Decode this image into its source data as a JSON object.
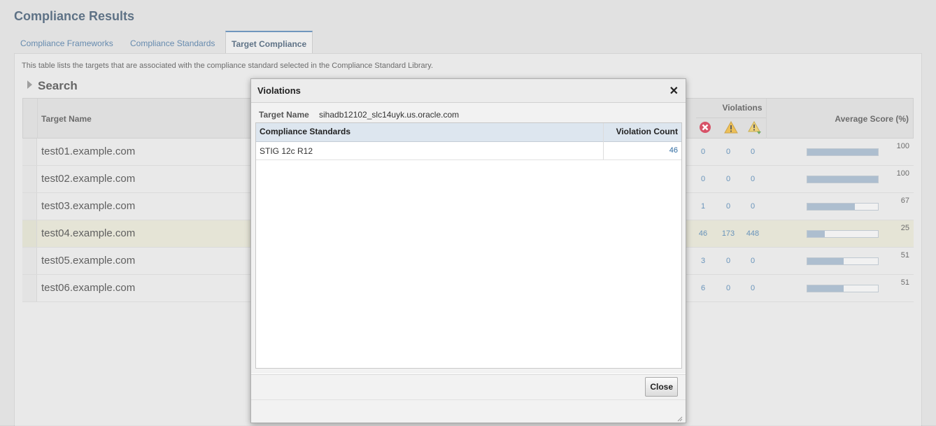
{
  "page": {
    "title": "Compliance Results"
  },
  "tabs": [
    {
      "label": "Compliance Frameworks",
      "active": false
    },
    {
      "label": "Compliance Standards",
      "active": false
    },
    {
      "label": "Target Compliance",
      "active": true
    }
  ],
  "description": "This table lists the targets that are associated with the compliance standard selected in the Compliance Standard Library.",
  "search": {
    "label": "Search"
  },
  "table": {
    "headers": {
      "target_name": "Target Name",
      "violations": "Violations",
      "average_score": "Average Score (%)"
    },
    "violation_icons": [
      "critical-icon",
      "warning-icon",
      "minor-warning-icon"
    ],
    "rows": [
      {
        "target": "test01.example.com",
        "critical": "0",
        "warning": "0",
        "minor": "0",
        "score": "100",
        "score_fraction": 1.0
      },
      {
        "target": "test02.example.com",
        "critical": "0",
        "warning": "0",
        "minor": "0",
        "score": "100",
        "score_fraction": 1.0
      },
      {
        "target": "test03.example.com",
        "critical": "1",
        "warning": "0",
        "minor": "0",
        "score": "67",
        "score_fraction": 0.67
      },
      {
        "target": "test04.example.com",
        "critical": "46",
        "warning": "173",
        "minor": "448",
        "score": "25",
        "score_fraction": 0.25,
        "selected": true
      },
      {
        "target": "test05.example.com",
        "critical": "3",
        "warning": "0",
        "minor": "0",
        "score": "51",
        "score_fraction": 0.51
      },
      {
        "target": "test06.example.com",
        "critical": "6",
        "warning": "0",
        "minor": "0",
        "score": "51",
        "score_fraction": 0.51
      }
    ]
  },
  "dialog": {
    "title": "Violations",
    "target_label": "Target Name",
    "target_value": "sihadb12102_slc14uyk.us.oracle.com",
    "columns": {
      "standard": "Compliance Standards",
      "count": "Violation Count"
    },
    "rows": [
      {
        "standard": "STIG 12c R12",
        "count": "46"
      }
    ],
    "close_label": "Close",
    "close_glyph": "✕"
  },
  "colors": {
    "title": "#1f3b57",
    "link": "#2e6aa0",
    "score_fill": "#8ea5bd",
    "critical": "#c8102e",
    "warning": "#e6a817"
  }
}
